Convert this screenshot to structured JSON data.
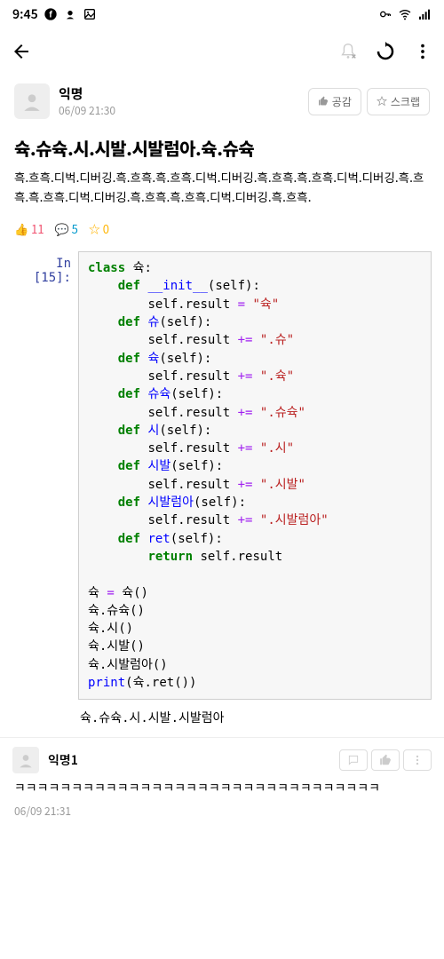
{
  "status": {
    "time": "9:45"
  },
  "post": {
    "author": "익명",
    "date": "06/09 21:30",
    "like_btn": "공감",
    "scrap_btn": "스크랩",
    "title": "슉.슈슉.시.시발.시발럼아.슉.슈슉",
    "body": "흑.흐흑.디벅.디버깅.흑.흐흑.흑.흐흑.디벅.디버깅.흑.흐흑.흑.흐흑.디벅.디버깅.흑.흐흑.흑.흐흑.디벅.디버깅.흑.흐흑.흑.흐흑.디벅.디버깅.흑.흐흑.",
    "stats": {
      "likes": "11",
      "comments": "5",
      "stars": "0"
    }
  },
  "code": {
    "prompt": "In [15]:",
    "class_kw": "class",
    "def_kw": "def",
    "return_kw": "return",
    "class_name": "슉",
    "init_name": "__init__",
    "self": "self",
    "result_attr": "result",
    "eq": "=",
    "pluseq": "+=",
    "str_init": "\"슉\"",
    "m_shu": "슈",
    "s_shu": "\".슈\"",
    "m_suk": "슉",
    "s_suk": "\".슉\"",
    "m_shusuk": "슈슉",
    "s_shusuk": "\".슈슉\"",
    "m_si": "시",
    "s_si": "\".시\"",
    "m_sibal": "시발",
    "s_sibal": "\".시발\"",
    "m_sibalruma": "시발럼아",
    "s_sibalruma": "\".시발럼아\"",
    "m_ret": "ret",
    "var": "슉",
    "call1": "슉.슈슉()",
    "call2": "슉.시()",
    "call3": "슉.시발()",
    "call4": "슉.시발럼아()",
    "print_fn": "print",
    "print_arg": "슉.ret()",
    "output": "슉.슈슉.시.시발.시발럼아"
  },
  "comment": {
    "author": "익명1",
    "body": "ㅋㅋㅋㅋㅋㅋㅋㅋㅋㅋㅋㅋㅋㅋㅋㅋㅋㅋㅋㅋㅋㅋㅋㅋㅋㅋㅋㅋㅋㅋㅋㅋ",
    "date": "06/09 21:31"
  }
}
